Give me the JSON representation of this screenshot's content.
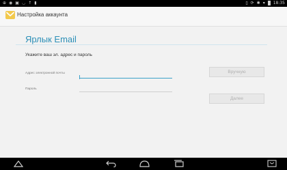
{
  "status_bar": {
    "left_icons": [
      "notification-icon",
      "notification-icon",
      "notification-icon",
      "notification-icon",
      "notification-icon",
      "notification-icon"
    ],
    "time": "18:35"
  },
  "action_bar": {
    "title": "Настройка аккаунта"
  },
  "page": {
    "title": "Ярлык Email",
    "instruction": "Укажите ваш эл. адрес и пароль"
  },
  "form": {
    "email_label": "Адрес электронной почты",
    "email_value": "",
    "password_label": "Пароль",
    "password_value": ""
  },
  "buttons": {
    "manual": "Вручную",
    "next": "Далее"
  },
  "nav_bar": {
    "icons": [
      "home-icon",
      "back-icon",
      "home-button-icon",
      "recent-apps-icon",
      "fullscreen-icon"
    ]
  }
}
